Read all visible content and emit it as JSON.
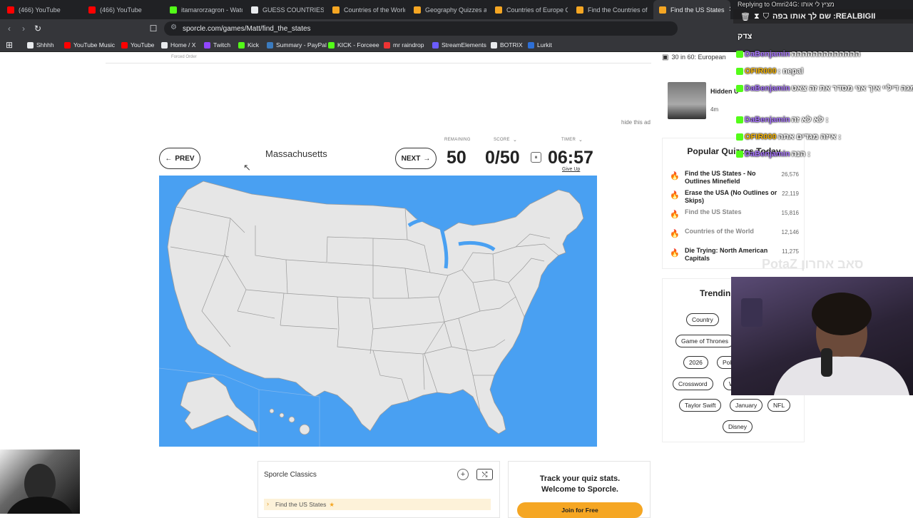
{
  "tabs": [
    {
      "label": "(466) YouTube",
      "icon": "youtube-icon",
      "color": "#ff0000"
    },
    {
      "label": "(466) YouTube",
      "icon": "youtube-icon",
      "color": "#ff0000"
    },
    {
      "label": "itamarorzagron - Watc",
      "icon": "kick-icon",
      "color": "#53fc18"
    },
    {
      "label": "GUESS COUNTRIES - J",
      "icon": "google-icon",
      "color": "#e8eaed"
    },
    {
      "label": "Countries of the World",
      "icon": "sporcle-icon",
      "color": "#f5a623"
    },
    {
      "label": "Geography Quizzes an",
      "icon": "sporcle-icon",
      "color": "#f5a623"
    },
    {
      "label": "Countries of Europe Q",
      "icon": "sporcle-icon",
      "color": "#f5a623"
    },
    {
      "label": "Find the Countries of",
      "icon": "sporcle-icon",
      "color": "#f5a623"
    },
    {
      "label": "Find the US States",
      "icon": "sporcle-icon",
      "color": "#f5a623",
      "active": true
    }
  ],
  "url": "sporcle.com/games/Matt/find_the_states",
  "bookmarks": [
    {
      "label": "Shhhh",
      "icon": "folder-icon",
      "color": "#e8eaed"
    },
    {
      "label": "YouTube Music",
      "icon": "youtube-music-icon",
      "color": "#ff0000"
    },
    {
      "label": "YouTube",
      "icon": "youtube-icon",
      "color": "#ff0000"
    },
    {
      "label": "Home / X",
      "icon": "x-icon",
      "color": "#e8eaed"
    },
    {
      "label": "Twitch",
      "icon": "twitch-icon",
      "color": "#9146ff"
    },
    {
      "label": "Kick",
      "icon": "kick-icon",
      "color": "#53fc18"
    },
    {
      "label": "Summary - PayPal",
      "icon": "paypal-icon",
      "color": "#3b7bbf"
    },
    {
      "label": "KICK - Forceee",
      "icon": "kick-icon",
      "color": "#53fc18"
    },
    {
      "label": "mr raindrop",
      "icon": "raindrop-icon",
      "color": "#e33"
    },
    {
      "label": "StreamElements",
      "icon": "streamelements-icon",
      "color": "#6b5cff"
    },
    {
      "label": "BOTRIX",
      "icon": "botrix-icon",
      "color": "#e8eaed"
    },
    {
      "label": "Lurkit",
      "icon": "lurkit-icon",
      "color": "#2d6fd6"
    }
  ],
  "quiz": {
    "forced_order": "Forced Order",
    "hide_ad": "hide this ad",
    "prev": "PREV",
    "next": "NEXT",
    "prompt": "Massachusetts",
    "remaining_label": "REMAINING",
    "remaining": "50",
    "score_label": "SCORE",
    "score": "0/50",
    "timer_label": "TIMER",
    "timer": "06:57",
    "give_up": "Give Up",
    "map_color": "#49a0f2",
    "state_color": "#e6e6e6"
  },
  "classics": {
    "title": "Sporcle Classics",
    "item": "Find the US States"
  },
  "track": {
    "line1": "Track your quiz stats.",
    "line2": "Welcome to Sporcle.",
    "join": "Join for Free"
  },
  "sidebar": {
    "top_strip": "30 in 60: European",
    "hidden_title": "Hidden U",
    "hidden_time": "4m",
    "popular_title": "Popular Quizzes Today",
    "popular": [
      {
        "name": "Find the US States - No Outlines Minefield",
        "count": "26,576",
        "dim": false,
        "flame": "#d22"
      },
      {
        "name": "Erase the USA (No Outlines or Skips)",
        "count": "22,119",
        "dim": false,
        "flame": "#d22"
      },
      {
        "name": "Find the US States",
        "count": "15,816",
        "dim": true,
        "flame": "#f39c12"
      },
      {
        "name": "Countries of the World",
        "count": "12,146",
        "dim": true,
        "flame": "#f39c12"
      },
      {
        "name": "Die Trying: North American Capitals",
        "count": "11,275",
        "dim": false,
        "flame": "#f39c12"
      }
    ],
    "trending_title": "Trendin",
    "trending": [
      "Country",
      "Game of Thrones",
      "2026",
      "Poké",
      "Crossword",
      "W",
      "Taylor Swift",
      "January",
      "NFL",
      "Disney"
    ]
  },
  "stream": {
    "webcam_name": "PotaZ סאב אחרון",
    "chat_reply": "Replying to Omri24G: מציץ לי אותו",
    "chat_top": "שם לך אותו בפה :REALBIGII",
    "chat_name_header": "צדק",
    "chat": [
      {
        "user": "DaBenjamin",
        "msg": "ההההההההההההה",
        "color": "#a874ff"
      },
      {
        "user": "OFIR000",
        "msg": ": nepal",
        "color": "#f7b500"
      },
      {
        "user": "DaBenjamin",
        "msg": "יש לי מגה דיליי איך אני מסדר את זה צאט",
        "color": "#a874ff"
      },
      {
        "user": "DaBenjamin",
        "msg": "לא לא זה :",
        "color": "#a874ff"
      },
      {
        "user": "OFIR000",
        "msg": "איזה מגדים אתה :",
        "color": "#f7b500"
      },
      {
        "user": "DaBenjamin",
        "msg": "הנה :",
        "color": "#a874ff"
      }
    ]
  }
}
